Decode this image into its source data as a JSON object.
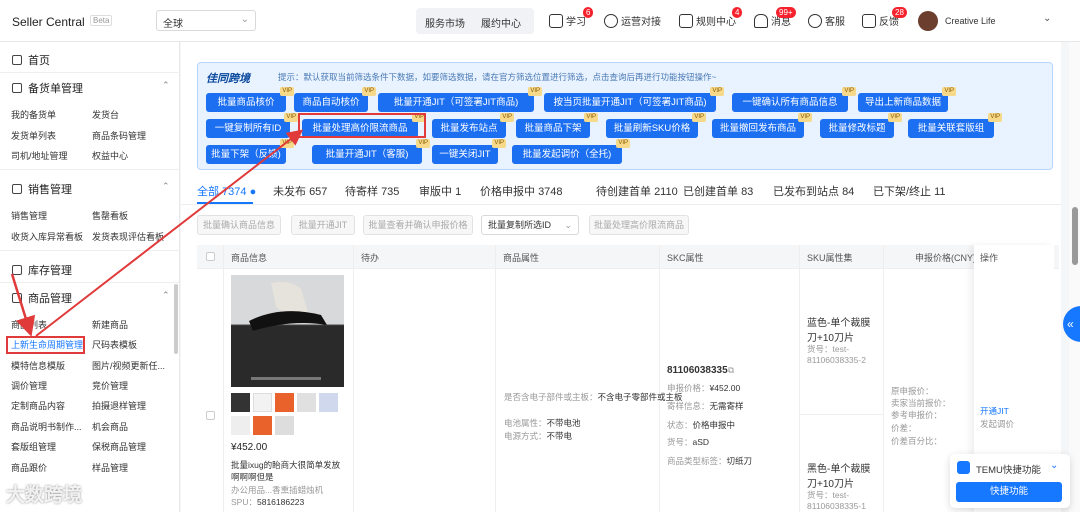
{
  "header": {
    "brand": "Seller Central",
    "beta": "Beta",
    "region": "全球",
    "nav": [
      "服务市场",
      "履约中心"
    ],
    "items": [
      {
        "label": "学习",
        "badge": "6",
        "icon": "book-icon"
      },
      {
        "label": "运营对接",
        "icon": "headset-icon"
      },
      {
        "label": "规则中心",
        "badge": "4",
        "icon": "rules-icon"
      },
      {
        "label": "消息",
        "badge": "99+",
        "icon": "bell-icon"
      },
      {
        "label": "客服",
        "icon": "service-icon"
      },
      {
        "label": "反馈",
        "badge": "28",
        "icon": "feedback-icon"
      }
    ],
    "user": "Creative Life"
  },
  "sidebar": {
    "home": "首页",
    "sections": [
      {
        "title": "备货单管理",
        "items": [
          "我的备货单",
          "发货台",
          "发货单列表",
          "商品条码管理",
          "司机/地址管理",
          "权益中心"
        ]
      },
      {
        "title": "销售管理",
        "items": [
          "销售管理",
          "售罄看板",
          "收货入库异常看板",
          "发货表现评估看板"
        ]
      },
      {
        "title": "库存管理",
        "items": []
      },
      {
        "title": "商品管理",
        "items": [
          "商品列表",
          "新建商品",
          "上新生命周期管理",
          "尺码表模板",
          "模特信息模版",
          "图片/视频更新任...",
          "调价管理",
          "竞价管理",
          "定制商品内容",
          "拍摄退样管理",
          "商品说明书制作...",
          "机会商品",
          "套版组管理",
          "保税商品管理",
          "商品跟价",
          "样品管理"
        ]
      }
    ]
  },
  "panel": {
    "logo": "佳同跨境",
    "tip": "提示：默认获取当前筛选条件下数据，如要筛选数据，请在官方筛选位置进行筛选，点击查询后再进行功能按钮操作~",
    "buttons": [
      "批量商品核价",
      "商品自动核价",
      "批量开通JIT（可签署JIT商品)",
      "按当页批量开通JIT（可签署JIT商品)",
      "一键确认所有商品信息",
      "导出上新商品数据",
      "一键复制所有ID",
      "批量处理高价限流商品",
      "批量发布站点",
      "批量商品下架",
      "批量刷新SKU价格",
      "批量撤回发布商品",
      "批量修改标题",
      "批量关联套版组",
      "批量下架（反馈)",
      "批量开通JIT（客服)",
      "一键关闭JIT",
      "批量发起调价（全托)"
    ],
    "vip": "VIP"
  },
  "tabs": [
    {
      "label": "全部",
      "count": "7374"
    },
    {
      "label": "未发布",
      "count": "657"
    },
    {
      "label": "待寄样",
      "count": "735"
    },
    {
      "label": "审版中",
      "count": "1"
    },
    {
      "label": "价格申报中",
      "count": "3748"
    },
    {
      "label": "待创建首单",
      "count": "2110"
    },
    {
      "label": "已创建首单",
      "count": "83"
    },
    {
      "label": "已发布到站点",
      "count": "84"
    },
    {
      "label": "已下架/终止",
      "count": "11"
    }
  ],
  "toolbar": {
    "b1": "批量确认商品信息",
    "b2": "批量开通JIT",
    "b3": "批量查看并确认申报价格",
    "select": "批量复制所选ID",
    "b4": "批量处理高价限流商品"
  },
  "table": {
    "headers": [
      "商品信息",
      "待办",
      "商品属性",
      "SKC属性",
      "SKU属性集",
      "申报价格(CNY)",
      "操作"
    ],
    "row": {
      "price": "¥452.00",
      "title1": "批量ixug的眙商大很简单发放",
      "title2": "啊啊啊但是",
      "category": "办公用品...香熏插蜡烛机",
      "spu_label": "SPU：",
      "spu": "5816186223",
      "attr1_label": "是否含电子部件或主板：",
      "attr1_value": "不含电子零部件或主板",
      "attr2_label": "电池属性：",
      "attr2_value": "不带电池",
      "attr3_label": "电源方式：",
      "attr3_value": "不带电",
      "skc": "81106038335",
      "skc_fields": [
        {
          "k": "申报价格：",
          "v": "¥452.00"
        },
        {
          "k": "寄样信息：",
          "v": "无需寄样"
        },
        {
          "k": "状态：",
          "v": "价格申报中"
        },
        {
          "k": "货号：",
          "v": "aSD"
        },
        {
          "k": "商品类型标签：",
          "v": "切纸刀"
        }
      ],
      "sku1_name": "蓝色-单个裁膜刀+10刀片",
      "sku1_code": "货号：test-81106038335-2",
      "sku2_name": "黑色-单个裁膜刀+10刀片",
      "sku2_code": "货号：test-81106038335-1",
      "price_fields": [
        "原申报价：",
        "卖家当前报价：",
        "参考申报价：",
        "价差：",
        "价差百分比："
      ],
      "actions": [
        "开通JIT",
        "发起调价"
      ]
    }
  },
  "quick": {
    "title": "TEMU快捷功能",
    "button": "快捷功能"
  },
  "watermark": "大数跨境"
}
